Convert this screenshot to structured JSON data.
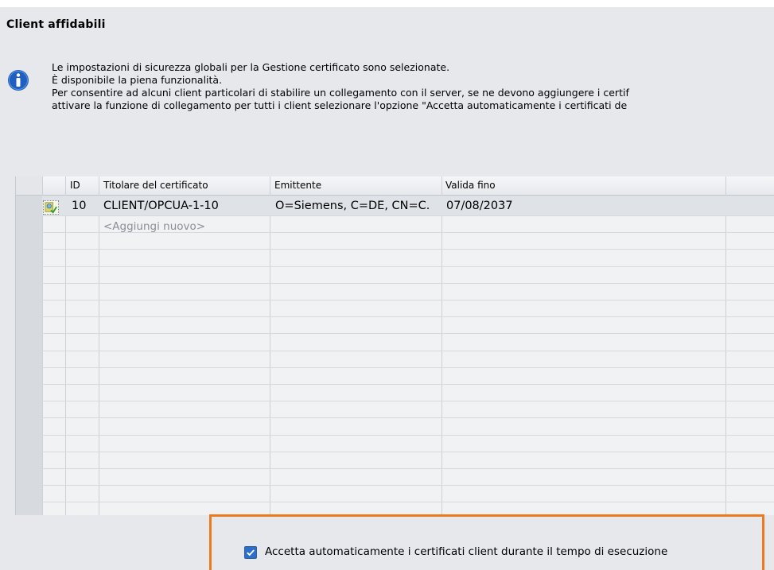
{
  "section": {
    "title": "Client affidabili"
  },
  "info": {
    "icon": "info-icon",
    "lines": [
      "Le impostazioni di sicurezza globali per la Gestione certificato sono selezionate.",
      "È disponibile la piena funzionalità.",
      "Per consentire ad alcuni client particolari di stabilire un collegamento con il server, se ne devono aggiungere i certif",
      "attivare la funzione di collegamento per tutti i client selezionare l'opzione \"Accetta automaticamente i certificati de"
    ]
  },
  "table": {
    "columns": [
      "ID",
      "Titolare del certificato",
      "Emittente",
      "Valida fino"
    ],
    "rows": [
      {
        "icon": "certificate-icon",
        "id": "10",
        "holder": "CLIENT/OPCUA-1-10",
        "issuer": "O=Siemens, C=DE, CN=C.",
        "valid_until": "07/08/2037"
      }
    ],
    "add_new_placeholder": "<Aggiungi nuovo>"
  },
  "options": {
    "auto_accept_label": "Accetta automaticamente i certificati client durante il tempo di esecuzione",
    "auto_accept_checked": true
  },
  "colors": {
    "callout_border": "#ee7a1e",
    "checkbox_fill": "#2b6fcb",
    "info_icon": "#1f5fbf"
  }
}
